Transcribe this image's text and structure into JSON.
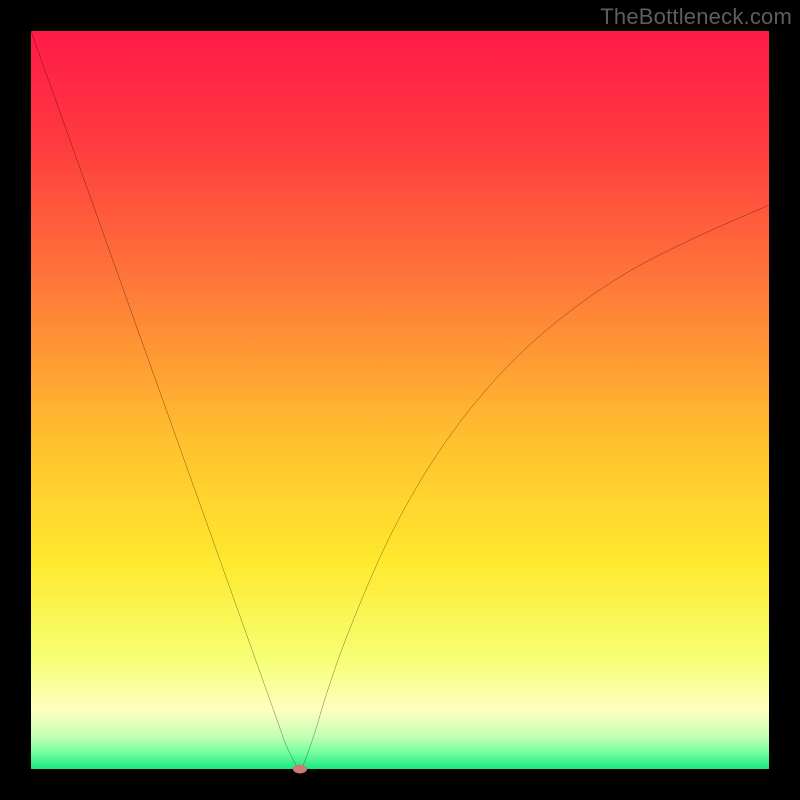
{
  "watermark": "TheBottleneck.com",
  "chart_data": {
    "type": "line",
    "title": "",
    "xlabel": "",
    "ylabel": "",
    "xlim": [
      0,
      100
    ],
    "ylim": [
      0,
      100
    ],
    "gradient_stops": [
      {
        "pos": 0,
        "color": "#ff1a49"
      },
      {
        "pos": 0.15,
        "color": "#ff3a3f"
      },
      {
        "pos": 0.35,
        "color": "#ff7a39"
      },
      {
        "pos": 0.55,
        "color": "#ffbf2e"
      },
      {
        "pos": 0.72,
        "color": "#ffe92e"
      },
      {
        "pos": 0.85,
        "color": "#f6ff74"
      },
      {
        "pos": 0.92,
        "color": "#feffbf"
      },
      {
        "pos": 0.955,
        "color": "#c6ffb4"
      },
      {
        "pos": 0.978,
        "color": "#74ff9e"
      },
      {
        "pos": 1.0,
        "color": "#17e880"
      }
    ],
    "series": [
      {
        "name": "curve",
        "x": [
          0.0,
          3.5,
          7.0,
          10.5,
          14.0,
          17.5,
          21.0,
          24.5,
          28.0,
          31.5,
          33.0,
          34.5,
          35.5,
          36.0,
          36.4,
          36.8,
          37.2,
          37.8,
          38.6,
          39.8,
          41.4,
          43.2,
          45.5,
          48.0,
          51.0,
          55.0,
          60.0,
          66.0,
          73.0,
          81.0,
          90.0,
          100.0
        ],
        "y": [
          100.0,
          90.2,
          80.4,
          70.6,
          60.8,
          51.0,
          41.2,
          31.4,
          21.6,
          11.8,
          7.6,
          3.4,
          1.3,
          0.4,
          0.0,
          0.4,
          1.3,
          3.0,
          5.4,
          9.4,
          14.2,
          19.0,
          24.6,
          30.2,
          36.0,
          42.6,
          49.4,
          56.0,
          62.0,
          67.4,
          72.0,
          76.4
        ]
      }
    ],
    "marker": {
      "x": 36.4,
      "y": 0.0,
      "color": "#cf7a75"
    },
    "curve_color": "#000000",
    "curve_width": 2
  }
}
